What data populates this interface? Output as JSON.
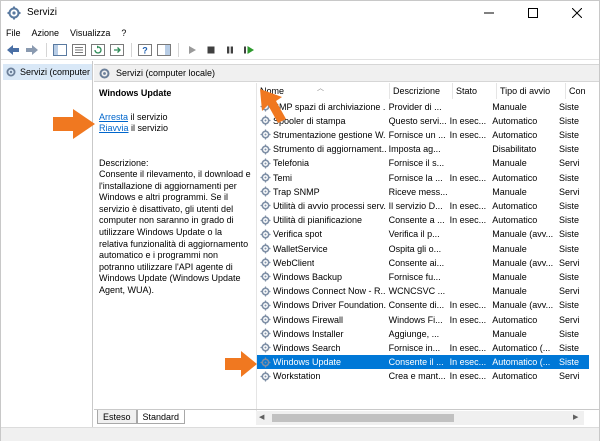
{
  "window": {
    "title": "Servizi"
  },
  "menu": [
    "File",
    "Azione",
    "Visualizza",
    "?"
  ],
  "tree": {
    "root_label": "Servizi (computer"
  },
  "pane": {
    "header": "Servizi (computer locale)"
  },
  "details": {
    "service_name": "Windows Update",
    "stop_link": "Arresta",
    "stop_suffix": " il servizio",
    "restart_link": "Riavvia",
    "restart_suffix": " il servizio",
    "description_label": "Descrizione:",
    "description_text": "Consente il rilevamento, il download e l'installazione di aggiornamenti per Windows e altri programmi. Se il servizio è disattivato, gli utenti del computer non saranno in grado di utilizzare Windows Update o la relativa funzionalità di aggiornamento automatico e i programmi non potranno utilizzare l'API agente di Windows Update (Windows Update Agent, WUA)."
  },
  "columns": {
    "name": "Nome",
    "description": "Descrizione",
    "status": "Stato",
    "startup": "Tipo di avvio",
    "logon": "Con"
  },
  "rows": [
    {
      "name": "SMP spazi di archiviazione ...",
      "description": "Provider di ...",
      "status": "",
      "startup": "Manuale",
      "logon": "Siste"
    },
    {
      "name": "Spooler di stampa",
      "description": "Questo servi...",
      "status": "In esec...",
      "startup": "Automatico",
      "logon": "Siste"
    },
    {
      "name": "Strumentazione gestione W...",
      "description": "Fornisce un ...",
      "status": "In esec...",
      "startup": "Automatico",
      "logon": "Siste"
    },
    {
      "name": "Strumento di aggiornament...",
      "description": "Imposta ag...",
      "status": "",
      "startup": "Disabilitato",
      "logon": "Siste"
    },
    {
      "name": "Telefonia",
      "description": "Fornisce il s...",
      "status": "",
      "startup": "Manuale",
      "logon": "Servi"
    },
    {
      "name": "Temi",
      "description": "Fornisce la ...",
      "status": "In esec...",
      "startup": "Automatico",
      "logon": "Siste"
    },
    {
      "name": "Trap SNMP",
      "description": "Riceve mess...",
      "status": "",
      "startup": "Manuale",
      "logon": "Servi"
    },
    {
      "name": "Utilità di avvio processi serv...",
      "description": "Il servizio D...",
      "status": "In esec...",
      "startup": "Automatico",
      "logon": "Siste"
    },
    {
      "name": "Utilità di pianificazione",
      "description": "Consente a ...",
      "status": "In esec...",
      "startup": "Automatico",
      "logon": "Siste"
    },
    {
      "name": "Verifica spot",
      "description": "Verifica il p...",
      "status": "",
      "startup": "Manuale (avv...",
      "logon": "Siste"
    },
    {
      "name": "WalletService",
      "description": "Ospita gli o...",
      "status": "",
      "startup": "Manuale",
      "logon": "Siste"
    },
    {
      "name": "WebClient",
      "description": "Consente ai...",
      "status": "",
      "startup": "Manuale (avv...",
      "logon": "Servi"
    },
    {
      "name": "Windows Backup",
      "description": "Fornisce fu...",
      "status": "",
      "startup": "Manuale",
      "logon": "Siste"
    },
    {
      "name": "Windows Connect Now - R...",
      "description": "WCNCSVC ...",
      "status": "",
      "startup": "Manuale",
      "logon": "Servi"
    },
    {
      "name": "Windows Driver Foundation...",
      "description": "Consente di...",
      "status": "In esec...",
      "startup": "Manuale (avv...",
      "logon": "Siste"
    },
    {
      "name": "Windows Firewall",
      "description": "Windows Fi...",
      "status": "In esec...",
      "startup": "Automatico",
      "logon": "Servi"
    },
    {
      "name": "Windows Installer",
      "description": "Aggiunge, ...",
      "status": "",
      "startup": "Manuale",
      "logon": "Siste"
    },
    {
      "name": "Windows Search",
      "description": "Fornisce in...",
      "status": "In esec...",
      "startup": "Automatico (...",
      "logon": "Siste"
    },
    {
      "name": "Windows Update",
      "description": "Consente il ...",
      "status": "In esec...",
      "startup": "Automatico (...",
      "logon": "Siste",
      "selected": true
    },
    {
      "name": "Workstation",
      "description": "Crea e mant...",
      "status": "In esec...",
      "startup": "Automatico",
      "logon": "Servi"
    }
  ],
  "tabs": [
    "Esteso",
    "Standard"
  ],
  "colors": {
    "selection": "#0078d7",
    "link": "#0066cc",
    "annotation": "#f07820"
  }
}
